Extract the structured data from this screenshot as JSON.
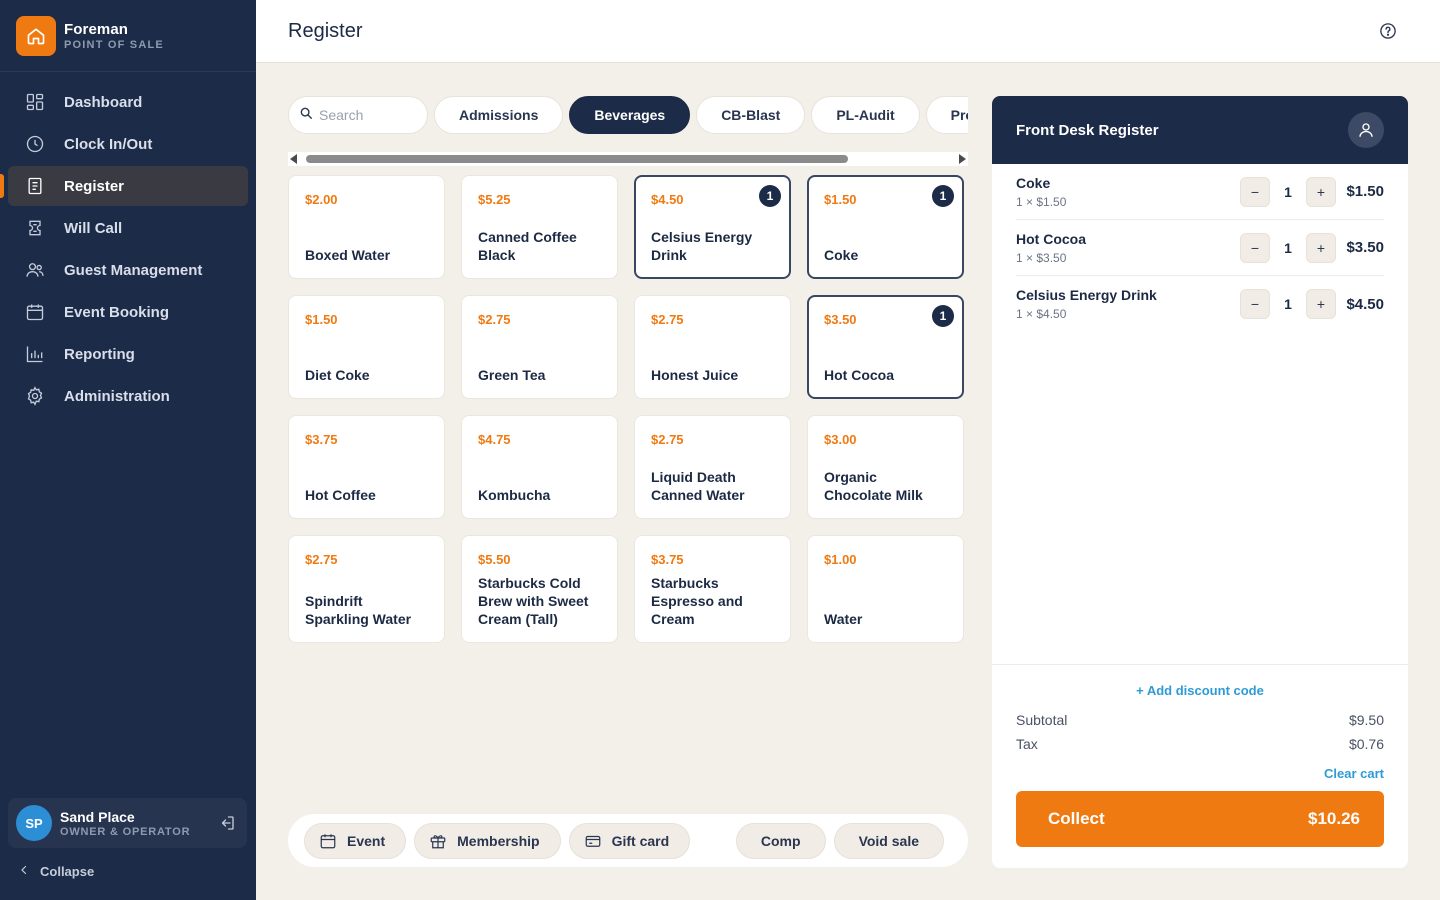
{
  "brand": {
    "name": "Foreman",
    "subtitle": "POINT OF SALE"
  },
  "nav": [
    {
      "label": "Dashboard",
      "icon": "dashboard-icon"
    },
    {
      "label": "Clock In/Out",
      "icon": "clock-icon"
    },
    {
      "label": "Register",
      "icon": "register-icon",
      "active": true
    },
    {
      "label": "Will Call",
      "icon": "ticket-icon"
    },
    {
      "label": "Guest Management",
      "icon": "users-icon"
    },
    {
      "label": "Event Booking",
      "icon": "calendar-icon"
    },
    {
      "label": "Reporting",
      "icon": "chart-icon"
    },
    {
      "label": "Administration",
      "icon": "gear-icon"
    }
  ],
  "user": {
    "initials": "SP",
    "name": "Sand Place",
    "role": "OWNER & OPERATOR"
  },
  "collapse_label": "Collapse",
  "header": {
    "title": "Register"
  },
  "search": {
    "placeholder": "Search"
  },
  "categories": [
    "Admissions",
    "Beverages",
    "CB-Blast",
    "PL-Audit",
    "Products"
  ],
  "active_category": "Beverages",
  "products": [
    {
      "price": "$2.00",
      "name": "Boxed Water"
    },
    {
      "price": "$5.25",
      "name": "Canned Coffee Black"
    },
    {
      "price": "$4.50",
      "name": "Celsius Energy Drink",
      "qty": "1"
    },
    {
      "price": "$1.50",
      "name": "Coke",
      "qty": "1"
    },
    {
      "price": "$1.50",
      "name": "Diet Coke"
    },
    {
      "price": "$2.75",
      "name": "Green Tea"
    },
    {
      "price": "$2.75",
      "name": "Honest Juice"
    },
    {
      "price": "$3.50",
      "name": "Hot Cocoa",
      "qty": "1"
    },
    {
      "price": "$3.75",
      "name": "Hot Coffee"
    },
    {
      "price": "$4.75",
      "name": "Kombucha"
    },
    {
      "price": "$2.75",
      "name": "Liquid Death Canned Water"
    },
    {
      "price": "$3.00",
      "name": "Organic Chocolate Milk"
    },
    {
      "price": "$2.75",
      "name": "Spindrift Sparkling Water"
    },
    {
      "price": "$5.50",
      "name": "Starbucks Cold Brew with Sweet Cream (Tall)"
    },
    {
      "price": "$3.75",
      "name": "Starbucks Espresso and Cream"
    },
    {
      "price": "$1.00",
      "name": "Water"
    }
  ],
  "actions": {
    "event": "Event",
    "membership": "Membership",
    "gift_card": "Gift card",
    "comp": "Comp",
    "void_sale": "Void sale"
  },
  "cart": {
    "title": "Front Desk Register",
    "lines": [
      {
        "name": "Coke",
        "sub": "1 × $1.50",
        "qty": "1",
        "total": "$1.50"
      },
      {
        "name": "Hot Cocoa",
        "sub": "1 × $3.50",
        "qty": "1",
        "total": "$3.50"
      },
      {
        "name": "Celsius Energy Drink",
        "sub": "1 × $4.50",
        "qty": "1",
        "total": "$4.50"
      }
    ],
    "minus": "−",
    "plus": "+",
    "discount_label": "+ Add discount code",
    "subtotal_label": "Subtotal",
    "subtotal": "$9.50",
    "tax_label": "Tax",
    "tax": "$0.76",
    "clear_label": "Clear cart",
    "collect_label": "Collect",
    "total": "$10.26"
  },
  "colors": {
    "sidebar": "#1c2b47",
    "accent": "#f07a12",
    "link": "#2e9bd6",
    "background": "#f3efe9"
  }
}
